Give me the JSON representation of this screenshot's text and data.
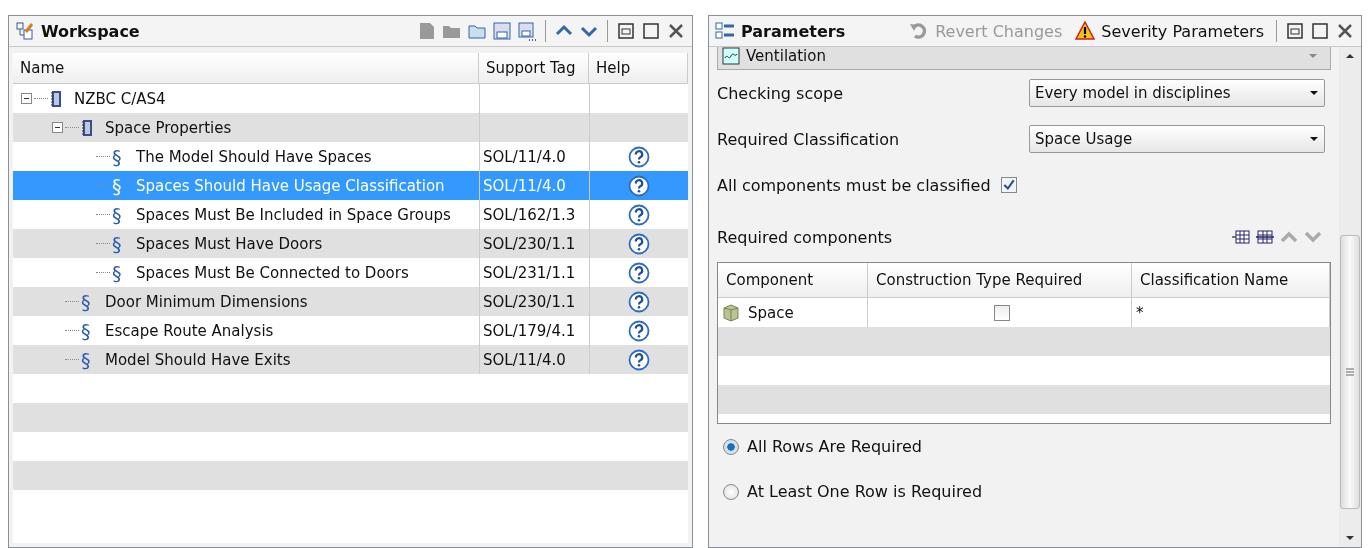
{
  "workspace": {
    "title": "Workspace",
    "columns": [
      "Name",
      "Support Tag",
      "Help"
    ],
    "tree": [
      {
        "label": "NZBC C/AS4",
        "kind": "book",
        "expanded": true,
        "selected": false,
        "children": [
          {
            "label": "Space Properties",
            "kind": "book",
            "expanded": true,
            "selected": false,
            "children": [
              {
                "label": "The Model Should Have Spaces",
                "kind": "rule",
                "marker": "§",
                "tag": "SOL/11/4.0",
                "selected": false
              },
              {
                "label": "Spaces Should Have Usage Classification",
                "kind": "rule",
                "marker": "§",
                "tag": "SOL/11/4.0",
                "selected": true
              },
              {
                "label": "Spaces Must Be Included in Space Groups",
                "kind": "rule",
                "marker": "§",
                "tag": "SOL/162/1.3",
                "selected": false
              },
              {
                "label": "Spaces Must Have Doors",
                "kind": "rule",
                "marker": "§",
                "tag": "SOL/230/1.1",
                "selected": false
              },
              {
                "label": "Spaces Must Be Connected to Doors",
                "kind": "rule",
                "marker": "§",
                "tag": "SOL/231/1.1",
                "selected": false
              }
            ]
          },
          {
            "label": "Door Minimum Dimensions",
            "kind": "rule",
            "marker": "§",
            "tag": "SOL/230/1.1",
            "selected": false
          },
          {
            "label": "Escape Route Analysis",
            "kind": "rule",
            "marker": "§",
            "tag": "SOL/179/4.1",
            "selected": false
          },
          {
            "label": "Model Should Have Exits",
            "kind": "rule",
            "marker": "§",
            "tag": "SOL/11/4.0",
            "selected": false
          }
        ]
      }
    ]
  },
  "parameters": {
    "title": "Parameters",
    "actions": [
      {
        "label": "Revert Changes",
        "kind": "revert",
        "disabled": true
      },
      {
        "label": "Severity Parameters",
        "kind": "severity",
        "disabled": false
      }
    ],
    "discipline": "Ventilation",
    "fields": [
      {
        "label": "Checking scope",
        "value": "Every model in disciplines"
      },
      {
        "label": "Required Classification",
        "value": "Space Usage"
      }
    ],
    "classified": {
      "label": "All components must be classified",
      "checked": true
    },
    "components": {
      "title": "Required components",
      "columns": [
        "Component",
        "Construction Type Required",
        "Classification Name"
      ],
      "rows": [
        {
          "component": "Space",
          "construction_required": false,
          "classification": "*"
        }
      ]
    },
    "options": [
      {
        "label": "All Rows Are Required",
        "selected": true
      },
      {
        "label": "At Least One Row is Required",
        "selected": false
      }
    ]
  }
}
